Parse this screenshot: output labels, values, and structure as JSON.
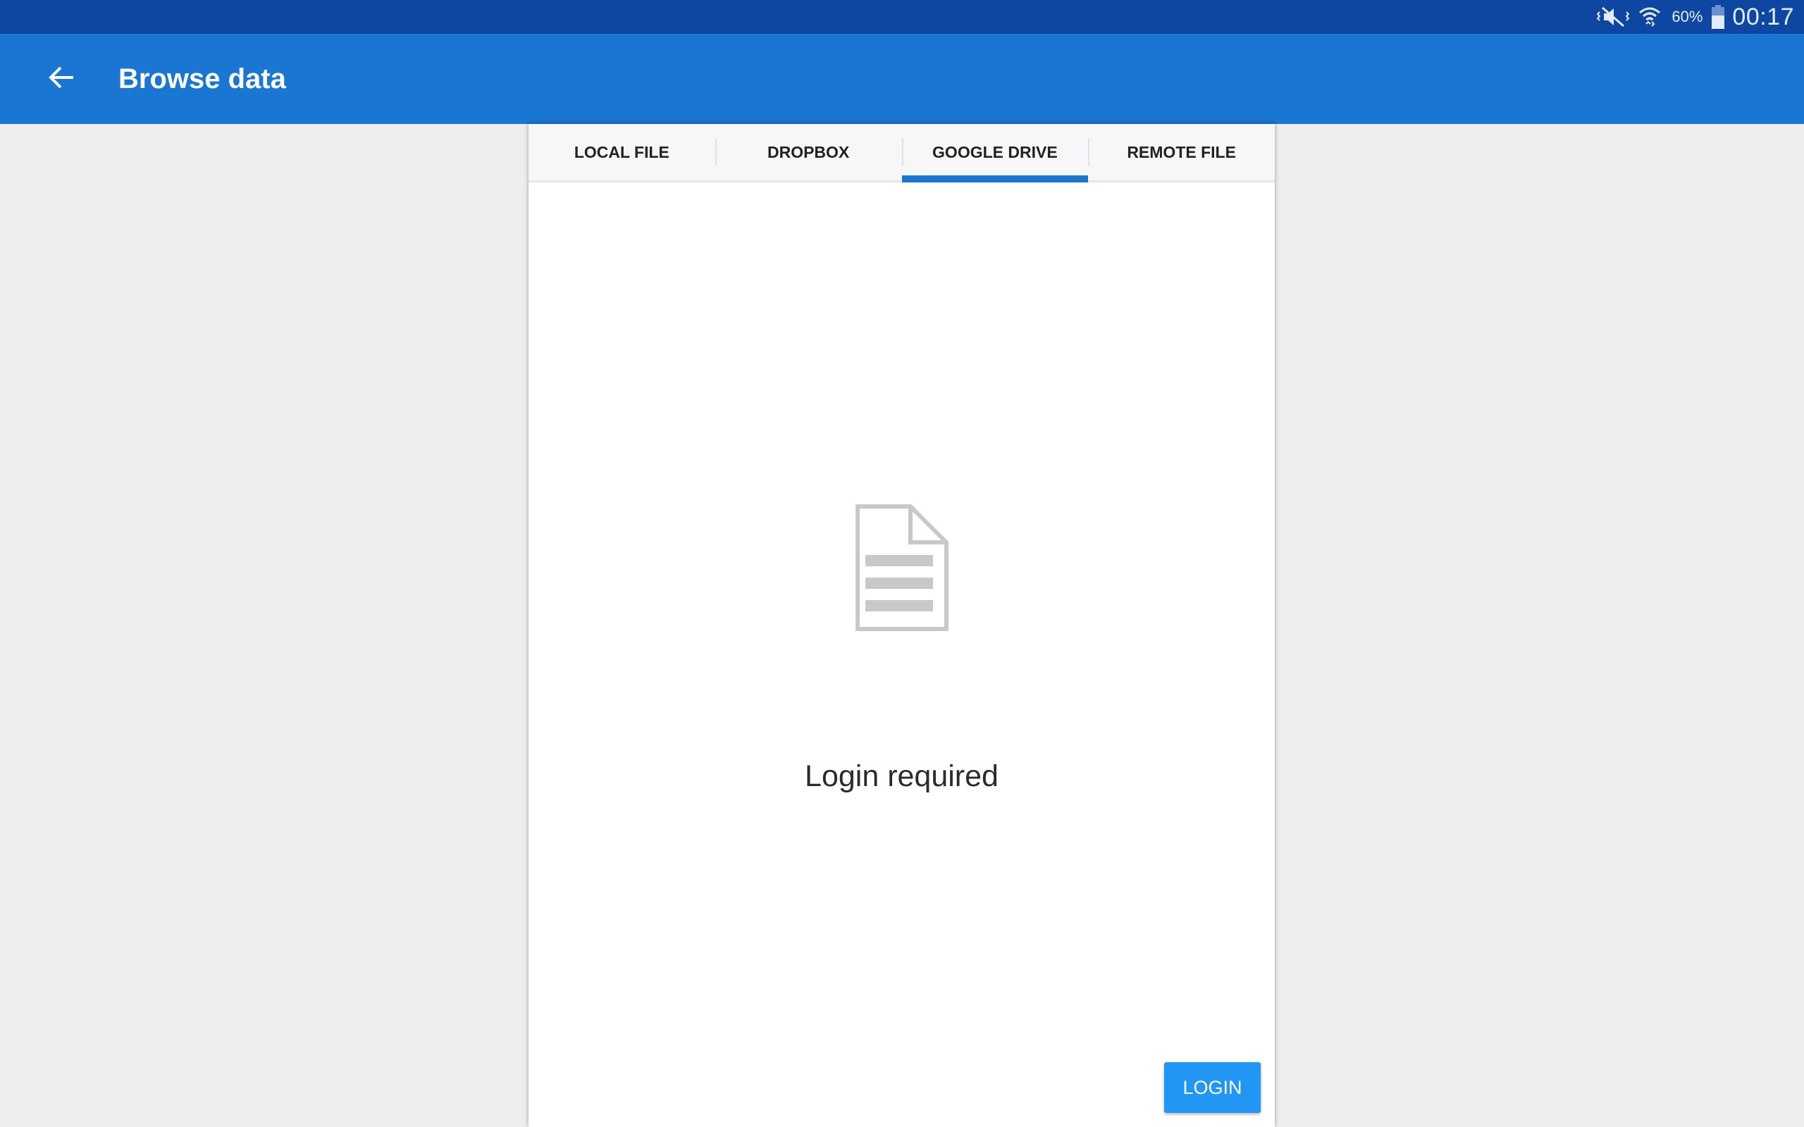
{
  "status_bar": {
    "battery_percent": "60%",
    "time": "00:17",
    "icons": [
      "vibrate-mute-icon",
      "wifi-icon",
      "battery-icon"
    ]
  },
  "app_bar": {
    "title": "Browse data",
    "back_icon": "arrow-back-icon"
  },
  "tabs": [
    {
      "label": "LOCAL FILE",
      "active": false
    },
    {
      "label": "DROPBOX",
      "active": false
    },
    {
      "label": "GOOGLE DRIVE",
      "active": true
    },
    {
      "label": "REMOTE FILE",
      "active": false
    }
  ],
  "empty_state": {
    "icon": "document-icon",
    "message": "Login required"
  },
  "login_button": {
    "label": "LOGIN"
  },
  "colors": {
    "status_bar": "#0d47a1",
    "app_bar": "#1976d2",
    "accent": "#2196f3",
    "background": "#eeeeee"
  }
}
